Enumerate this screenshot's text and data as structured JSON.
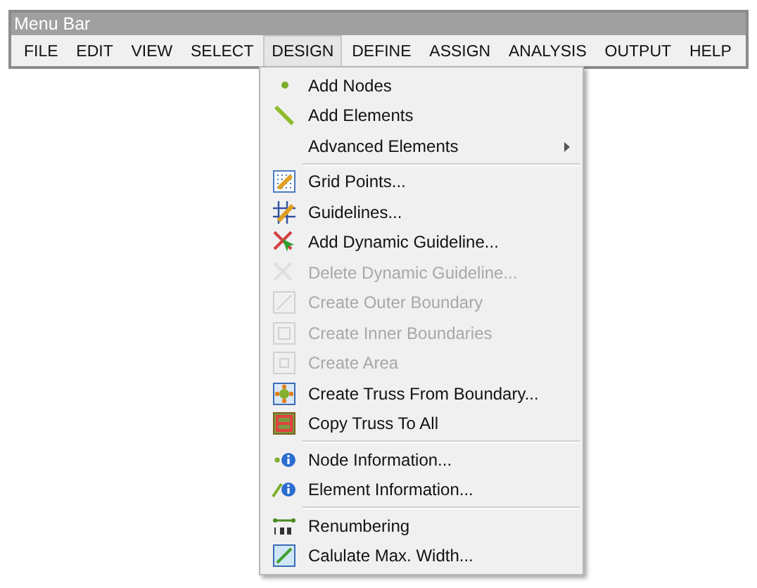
{
  "window": {
    "title": "Menu Bar"
  },
  "menus": [
    {
      "label": "FILE",
      "selected": false
    },
    {
      "label": "EDIT",
      "selected": false
    },
    {
      "label": "VIEW",
      "selected": false
    },
    {
      "label": "SELECT",
      "selected": false
    },
    {
      "label": "DESIGN",
      "selected": true
    },
    {
      "label": "DEFINE",
      "selected": false
    },
    {
      "label": "ASSIGN",
      "selected": false
    },
    {
      "label": "ANALYSIS",
      "selected": false
    },
    {
      "label": "OUTPUT",
      "selected": false
    },
    {
      "label": "HELP",
      "selected": false
    }
  ],
  "dropdown": {
    "items": [
      {
        "kind": "item",
        "label": "Add Nodes",
        "disabled": false
      },
      {
        "kind": "item",
        "label": "Add Elements",
        "disabled": false
      },
      {
        "kind": "submenu",
        "label": "Advanced Elements",
        "disabled": false
      },
      {
        "kind": "separator"
      },
      {
        "kind": "item",
        "label": "Grid Points...",
        "disabled": false
      },
      {
        "kind": "item",
        "label": "Guidelines...",
        "disabled": false
      },
      {
        "kind": "item",
        "label": "Add Dynamic Guideline...",
        "disabled": false
      },
      {
        "kind": "item",
        "label": "Delete Dynamic Guideline...",
        "disabled": true
      },
      {
        "kind": "item",
        "label": "Create Outer Boundary",
        "disabled": true
      },
      {
        "kind": "item",
        "label": "Create Inner Boundaries",
        "disabled": true
      },
      {
        "kind": "item",
        "label": "Create Area",
        "disabled": true
      },
      {
        "kind": "item",
        "label": "Create Truss From Boundary...",
        "disabled": false
      },
      {
        "kind": "item",
        "label": "Copy Truss To All",
        "disabled": false
      },
      {
        "kind": "separator"
      },
      {
        "kind": "item",
        "label": "Node Information...",
        "disabled": false
      },
      {
        "kind": "item",
        "label": "Element Information...",
        "disabled": false
      },
      {
        "kind": "separator"
      },
      {
        "kind": "item",
        "label": "Renumbering",
        "disabled": false
      },
      {
        "kind": "item",
        "label": "Calulate Max. Width...",
        "disabled": false
      }
    ]
  }
}
